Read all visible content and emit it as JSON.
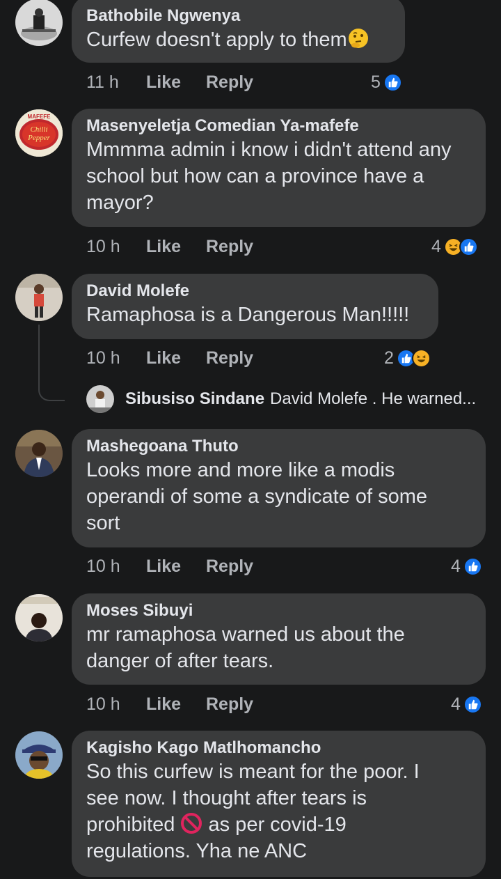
{
  "comments": [
    {
      "name": "Bathobile Ngwenya",
      "text": "Curfew doesn't apply to them",
      "time": "11 h",
      "like": "Like",
      "reply": "Reply",
      "reaction_count": "5",
      "reactions": [
        "like"
      ],
      "emoji": "thinking-emoji"
    },
    {
      "name": "Masenyeletja Comedian Ya-mafefe",
      "lines": [
        "Mmmma admin i know i didn't attend any",
        "school but how can a province have a",
        "mayor?"
      ],
      "avatar_text": [
        "MAFEFE",
        "Chilli",
        "Pepper"
      ],
      "time": "10 h",
      "like": "Like",
      "reply": "Reply",
      "reaction_count": "4",
      "reactions": [
        "haha",
        "like"
      ]
    },
    {
      "name": "David Molefe",
      "text": "Ramaphosa is a Dangerous Man!!!!!",
      "time": "10 h",
      "like": "Like",
      "reply": "Reply",
      "reaction_count": "2",
      "reactions": [
        "like",
        "haha"
      ]
    },
    {
      "name": "Mashegoana Thuto",
      "lines": [
        "Looks more and more like a modis",
        "operandi of some a syndicate of some",
        "sort"
      ],
      "time": "10 h",
      "like": "Like",
      "reply": "Reply",
      "reaction_count": "4",
      "reactions": [
        "like"
      ]
    },
    {
      "name": "Moses Sibuyi",
      "lines": [
        "mr ramaphosa warned us about the",
        "danger of after tears."
      ],
      "time": "10 h",
      "like": "Like",
      "reply": "Reply",
      "reaction_count": "4",
      "reactions": [
        "like"
      ]
    },
    {
      "name": "Kagisho Kago Matlhomancho",
      "lines": [
        "So this curfew is meant for the poor. I",
        "see now. I thought after tears is",
        "prohibited",
        "as per covid-19",
        "regulations. Yha ne ANC"
      ],
      "emoji": "prohibited-emoji"
    }
  ],
  "reply_preview": {
    "name": "Sibusiso Sindane",
    "text": "David Molefe . He warned..."
  },
  "colors": {
    "background": "#18191a",
    "bubble": "#3a3b3c",
    "like_blue": "#1877f2",
    "haha_yellow": "#f7b125",
    "muted": "#b0b3b8"
  }
}
